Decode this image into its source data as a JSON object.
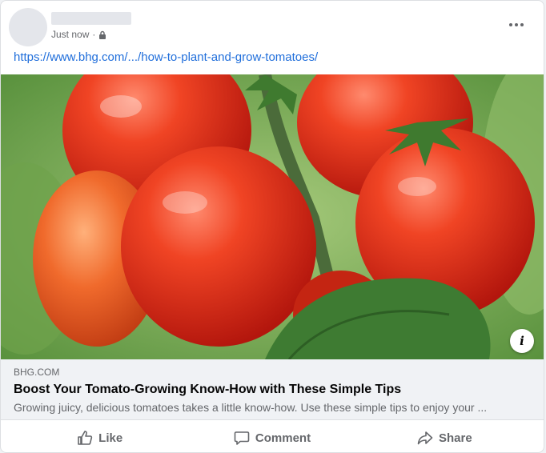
{
  "post": {
    "timestamp": "Just now",
    "separator": "·",
    "privacy_icon": "lock-icon",
    "more_icon": "more-options-icon",
    "link_url_text": "https://www.bhg.com/.../how-to-plant-and-grow-tomatoes/"
  },
  "preview": {
    "domain": "BHG.COM",
    "title": "Boost Your Tomato-Growing Know-How with These Simple Tips",
    "description": "Growing juicy, delicious tomatoes takes a little know-how. Use these simple tips to enjoy your ...",
    "info_icon": "info-icon",
    "info_glyph": "i"
  },
  "actions": {
    "like": "Like",
    "comment": "Comment",
    "share": "Share"
  },
  "colors": {
    "link": "#216fdb",
    "muted": "#65676b",
    "preview_bg": "#f0f2f5"
  }
}
